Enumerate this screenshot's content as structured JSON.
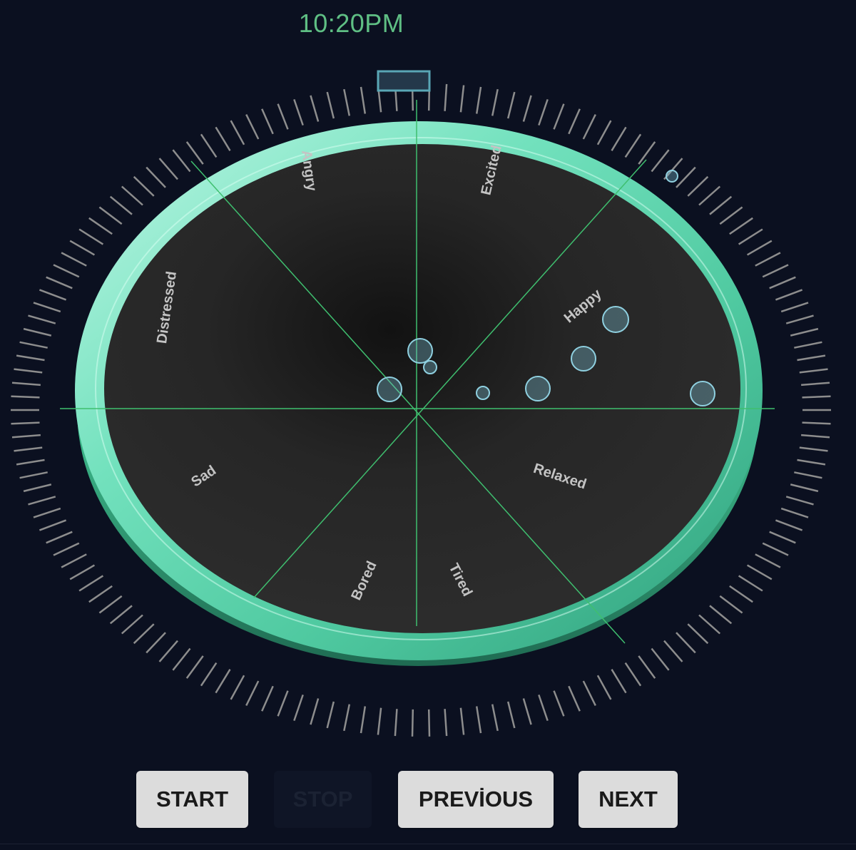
{
  "clock": {
    "time": "10:20PM"
  },
  "emotions": [
    "Excited",
    "Happy",
    "Relaxed",
    "Tired",
    "Bored",
    "Sad",
    "Distressed",
    "Angry"
  ],
  "controls": {
    "start": "START",
    "stop": "STOP",
    "previous": "PREVİOUS",
    "next": "NEXT"
  },
  "colors": {
    "background": "#0b1020",
    "accent": "#5fbf84",
    "ring": "#6ce0b4",
    "dial_face": "#2a2a2a",
    "bubble": "#7fc4d6"
  },
  "icons": [
    "time-indicator-icon"
  ]
}
